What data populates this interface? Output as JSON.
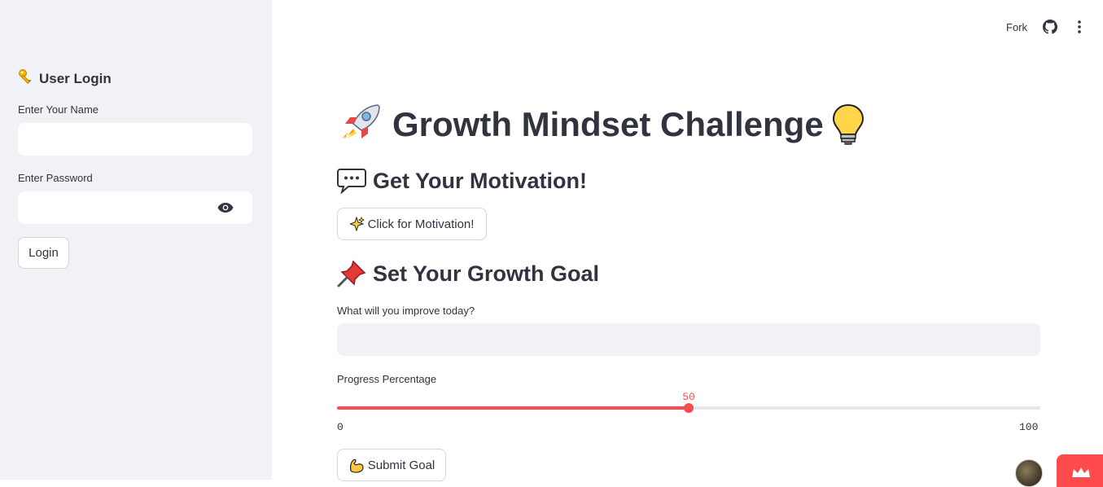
{
  "sidebar": {
    "title": "User Login",
    "title_icon": "key-icon",
    "name_label": "Enter Your Name",
    "name_value": "",
    "password_label": "Enter Password",
    "password_value": "",
    "login_button": "Login"
  },
  "header": {
    "fork_label": "Fork",
    "github_icon": "github-icon",
    "menu_icon": "kebab-menu-icon"
  },
  "main": {
    "title": "Growth Mindset Challenge",
    "title_icon_left": "rocket-icon",
    "title_icon_right": "light-bulb-icon",
    "motivation_heading": "Get Your Motivation!",
    "motivation_icon": "speech-bubble-icon",
    "motivation_button": "Click for Motivation!",
    "motivation_button_icon": "sparkles-icon",
    "goal_heading": "Set Your Growth Goal",
    "goal_icon": "pushpin-icon",
    "goal_label": "What will you improve today?",
    "goal_value": "",
    "progress_label": "Progress Percentage",
    "progress_value": "50",
    "progress_min": "0",
    "progress_max": "100",
    "submit_button": "Submit Goal",
    "submit_button_icon": "flexed-biceps-icon"
  },
  "colors": {
    "accent": "#ff4b4b",
    "sidebar_bg": "#f0f2f6",
    "text": "#31333f"
  }
}
